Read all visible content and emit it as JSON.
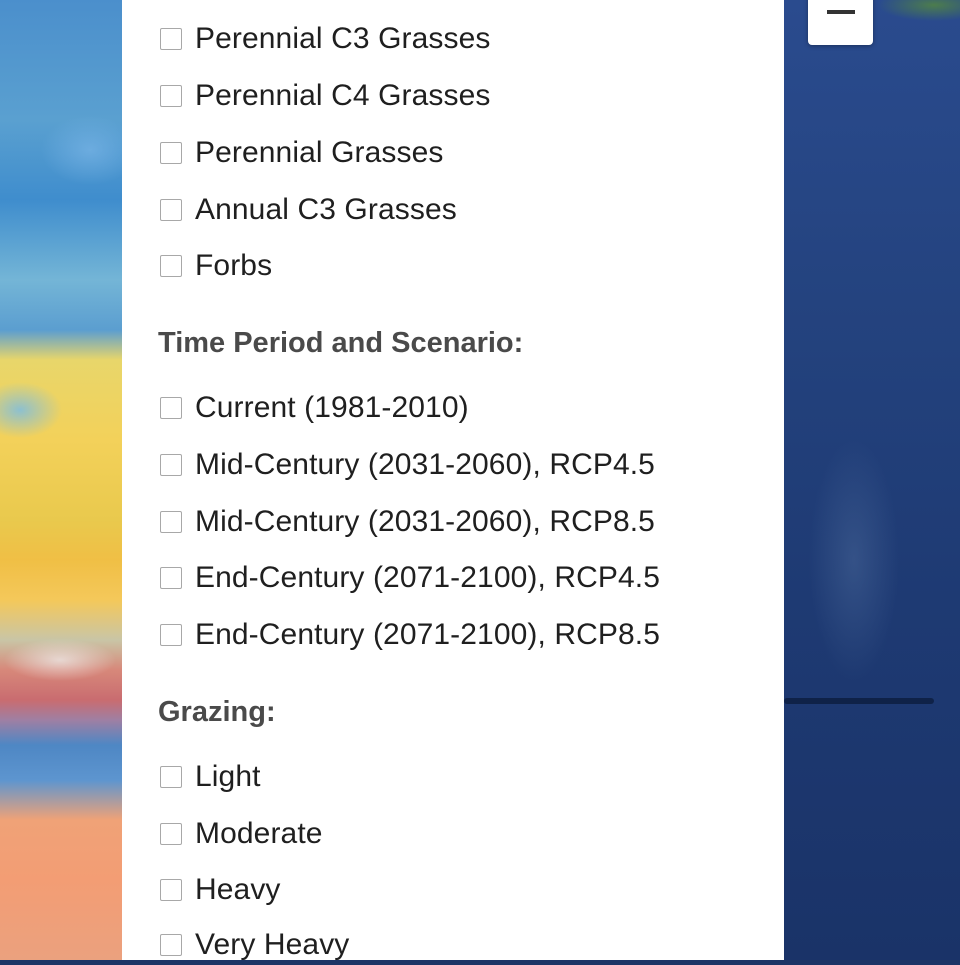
{
  "map": {
    "zoom_out_label": "−"
  },
  "filters": {
    "vegetation": {
      "options": [
        {
          "label": "Perennial C3 Grasses",
          "checked": false
        },
        {
          "label": "Perennial C4 Grasses",
          "checked": false
        },
        {
          "label": "Perennial Grasses",
          "checked": false
        },
        {
          "label": "Annual C3 Grasses",
          "checked": false
        },
        {
          "label": "Forbs",
          "checked": false
        }
      ]
    },
    "time_period": {
      "heading": "Time Period and Scenario:",
      "options": [
        {
          "label": "Current (1981-2010)",
          "checked": false
        },
        {
          "label": "Mid-Century (2031-2060), RCP4.5",
          "checked": false
        },
        {
          "label": "Mid-Century (2031-2060), RCP8.5",
          "checked": false
        },
        {
          "label": "End-Century (2071-2100), RCP4.5",
          "checked": false
        },
        {
          "label": "End-Century (2071-2100), RCP8.5",
          "checked": false
        }
      ]
    },
    "grazing": {
      "heading": "Grazing:",
      "options": [
        {
          "label": "Light",
          "checked": false
        },
        {
          "label": "Moderate",
          "checked": false
        },
        {
          "label": "Heavy",
          "checked": false
        },
        {
          "label": "Very Heavy",
          "checked": false
        }
      ]
    }
  },
  "colors": {
    "panel_bg": "#ffffff",
    "heading_text": "#4a4a4a",
    "label_text": "#1f1f1f",
    "checkbox_border": "#a8a8a8"
  }
}
